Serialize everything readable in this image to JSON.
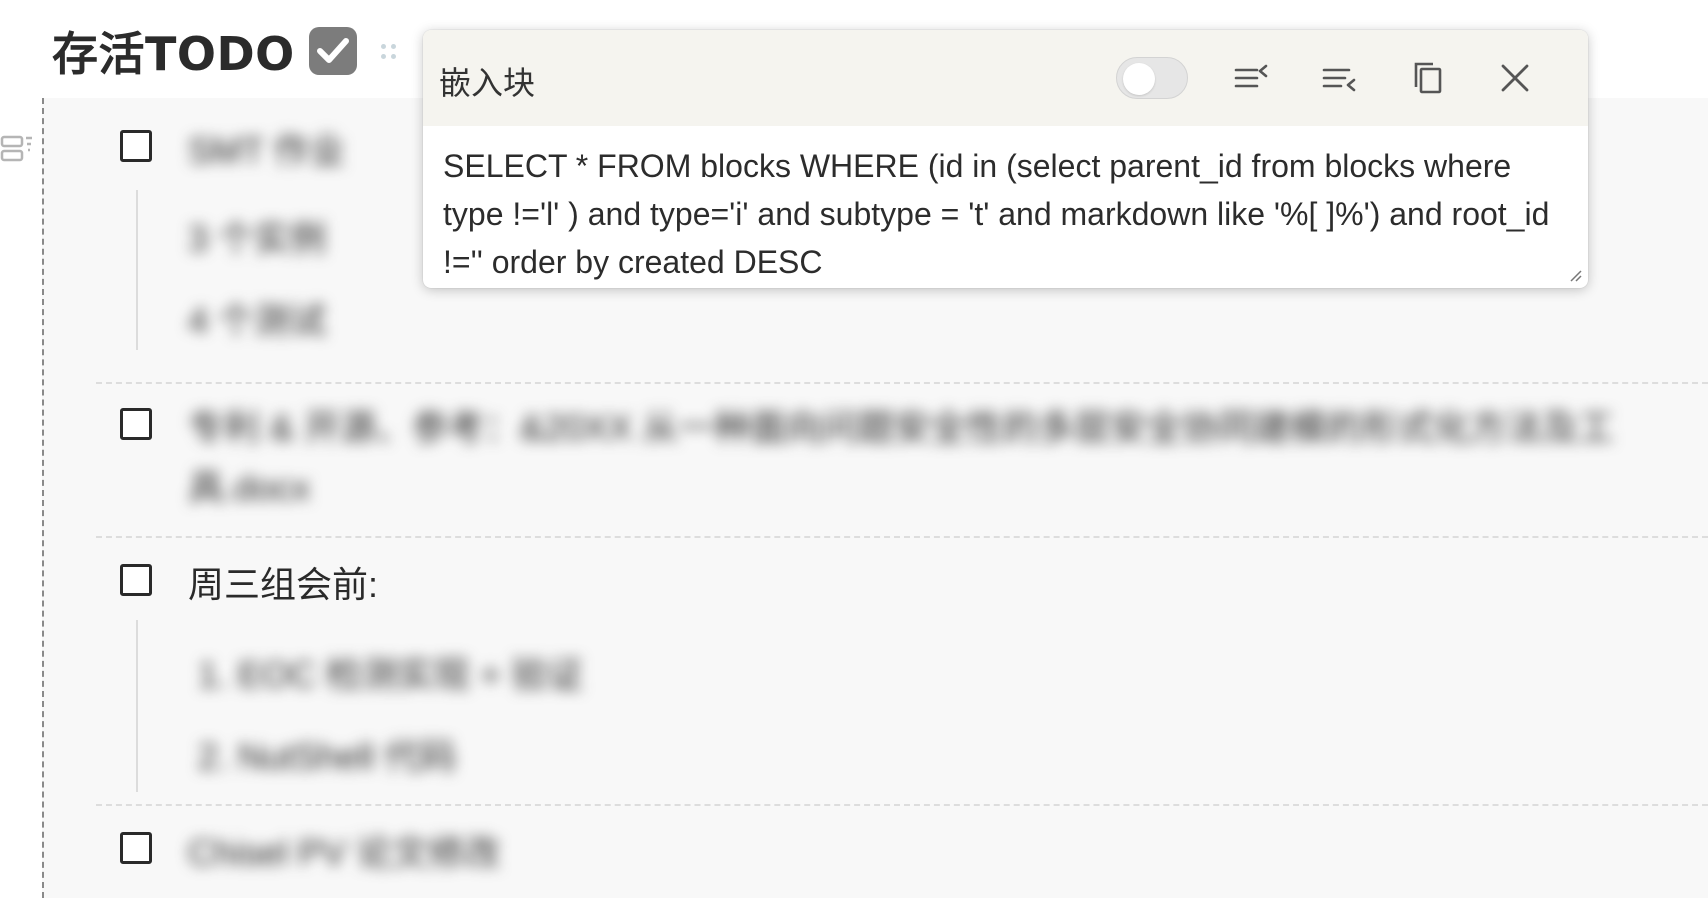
{
  "heading": {
    "title": "存活TODO",
    "emoji_icon": "check-mark-button-icon"
  },
  "embed": {
    "items": [
      {
        "label": "SMT 作业",
        "checked": false,
        "blurred": true,
        "children": [
          "3 个实例",
          "4 个测试"
        ]
      },
      {
        "label": "专利 & 开源、参考：&20XX 从一种面向问题安全性的多层安全协同建模的形式化方法及工具.docx",
        "checked": false,
        "blurred": true,
        "children": []
      },
      {
        "label": "周三组会前:",
        "checked": false,
        "blurred": false,
        "children": [
          "1.  EOC 检测实现 + 验证",
          "2.  NutShell 代码"
        ]
      },
      {
        "label": "Chisel PV 论文修改",
        "checked": false,
        "blurred": true,
        "children": []
      }
    ]
  },
  "popover": {
    "title": "嵌入块",
    "toggle_on": false,
    "buttons": [
      "collapse-icon",
      "expand-icon",
      "copy-icon",
      "close-icon"
    ],
    "sql": "SELECT * FROM blocks WHERE (id in (select parent_id from blocks where type !='l' ) and type='i' and subtype = 't' and markdown like '%[ ]%') and root_id !='' order by created DESC"
  }
}
